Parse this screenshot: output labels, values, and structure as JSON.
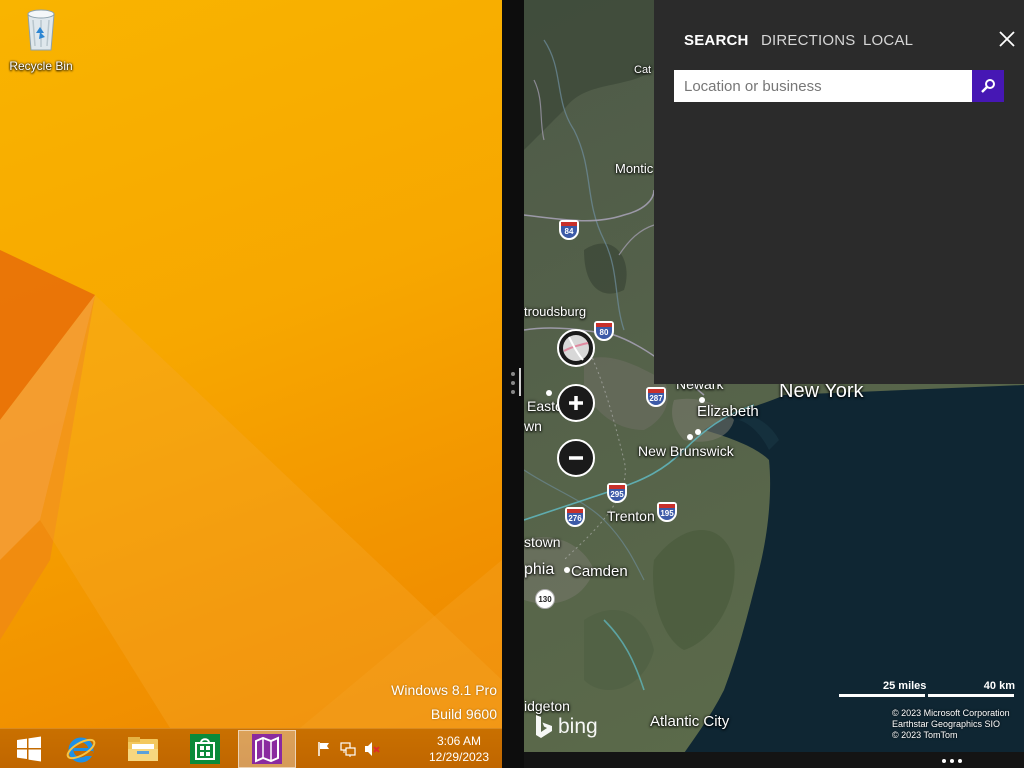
{
  "desktop": {
    "recycle_bin_label": "Recycle Bin",
    "watermark_line1": "Windows 8.1 Pro",
    "watermark_line2": "Build 9600"
  },
  "taskbar": {
    "items": [
      {
        "name": "start-button",
        "icon": "windows-logo-icon"
      },
      {
        "name": "internet-explorer",
        "icon": "internet-explorer-icon"
      },
      {
        "name": "file-explorer",
        "icon": "folder-icon"
      },
      {
        "name": "store",
        "icon": "store-icon"
      },
      {
        "name": "maps",
        "icon": "maps-icon",
        "active": true
      }
    ],
    "tray": [
      "action-center-flag-icon",
      "network-icon",
      "volume-muted-icon"
    ],
    "clock_time": "3:06 AM",
    "clock_date": "12/29/2023"
  },
  "maps": {
    "panel": {
      "tabs": [
        {
          "label": "SEARCH",
          "active": true
        },
        {
          "label": "DIRECTIONS",
          "active": false
        },
        {
          "label": "LOCAL",
          "active": false
        }
      ],
      "search_placeholder": "Location or business",
      "search_value": ""
    },
    "labels": {
      "cat": "Cat",
      "monticello": "Montic",
      "stroudsburg": "troudsburg",
      "newark": "Newark",
      "new_york": "New York",
      "elizabeth": "Elizabeth",
      "easton1": "Easto",
      "easton2": "wn",
      "new_brunswick": "New Brunswick",
      "trenton": "Trenton",
      "stown": "stown",
      "phia": "phia",
      "camden": "Camden",
      "idgeton": "idgeton",
      "atlantic_city": "Atlantic City"
    },
    "shields": {
      "i84": "84",
      "i80": "80",
      "i287": "287",
      "i295": "295",
      "i195": "195",
      "i276": "276",
      "r130": "130"
    },
    "scale": {
      "miles": "25 miles",
      "km": "40 km"
    },
    "copyright": [
      "© 2023 Microsoft Corporation",
      "Earthstar Geographics  SIO",
      "© 2023 TomTom"
    ],
    "bing_word": "bing",
    "colors": {
      "search_button": "#4617b4",
      "panel_bg": "#2b2b2b",
      "water": "#0f2633"
    }
  }
}
